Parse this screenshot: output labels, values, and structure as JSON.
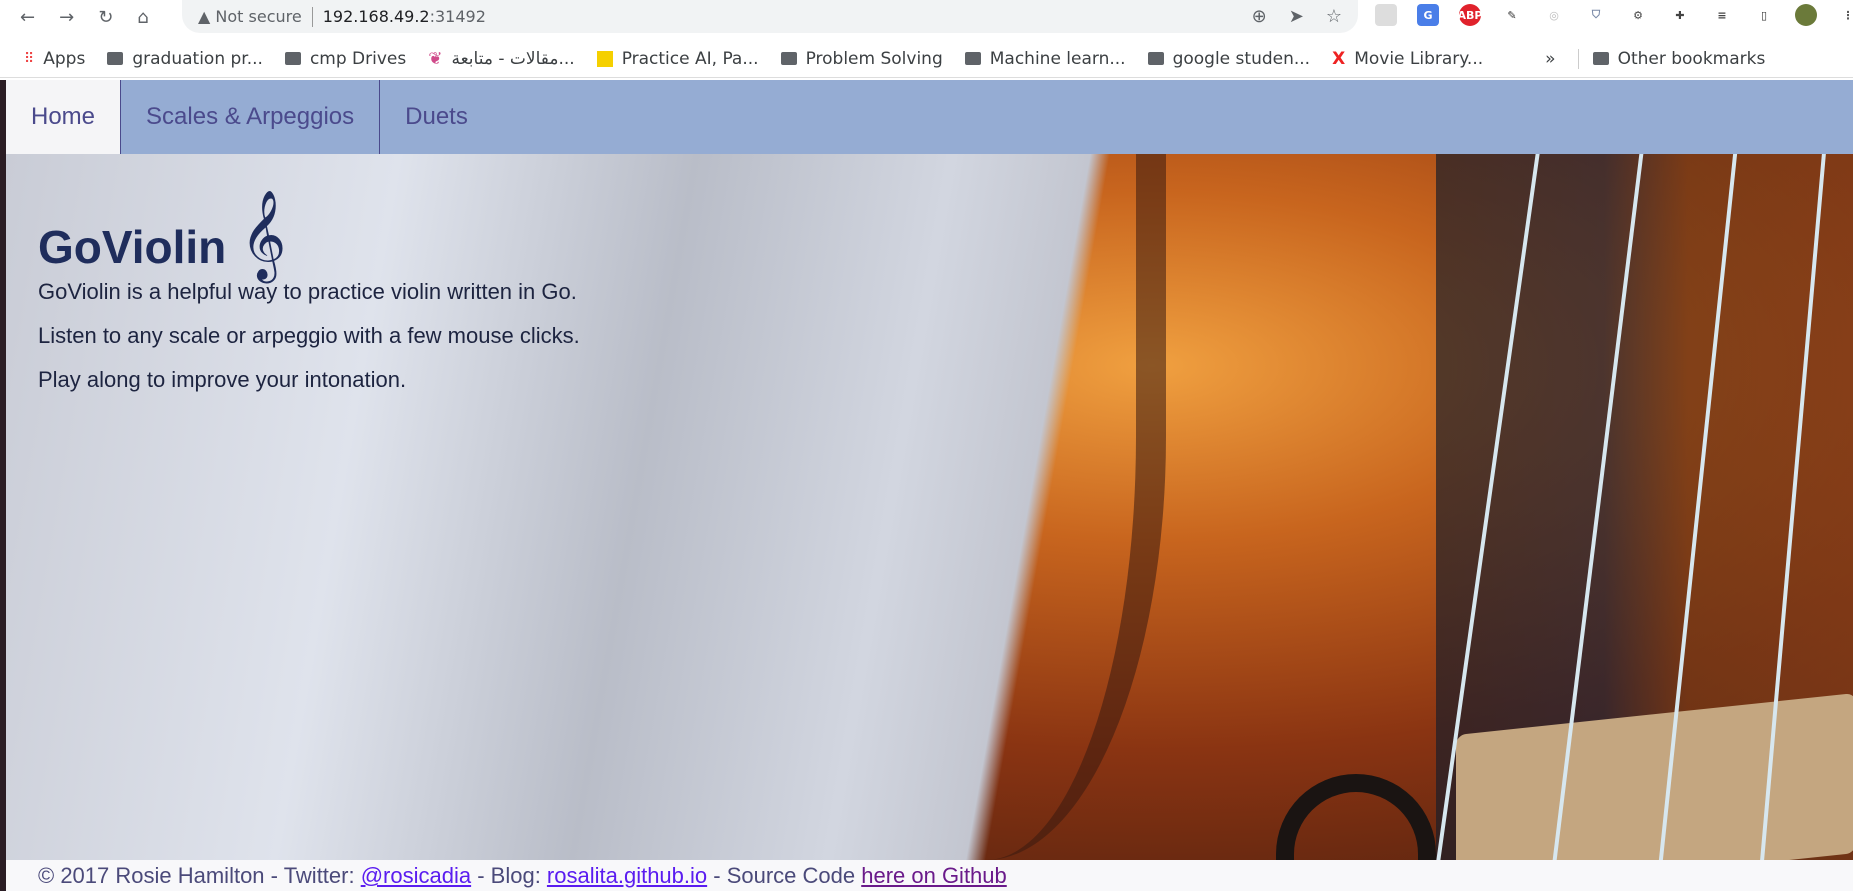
{
  "browser": {
    "security_label": "Not secure",
    "url_host": "192.168.49.2",
    "url_port": ":31492",
    "bookmarks": [
      {
        "label": "Apps",
        "icon": "apps-grid-icon"
      },
      {
        "label": "graduation pr...",
        "icon": "folder-icon"
      },
      {
        "label": "cmp Drives",
        "icon": "folder-icon"
      },
      {
        "label": "مقالات - متابعة...",
        "icon": "site-icon"
      },
      {
        "label": "Practice AI, Pa...",
        "icon": "site-icon"
      },
      {
        "label": "Problem Solving",
        "icon": "folder-icon"
      },
      {
        "label": "Machine learn...",
        "icon": "folder-icon"
      },
      {
        "label": "google studen...",
        "icon": "folder-icon"
      },
      {
        "label": "Movie Library...",
        "icon": "x-icon"
      }
    ],
    "overflow": "»",
    "other_bookmarks": "Other bookmarks"
  },
  "nav": {
    "tabs": [
      {
        "label": "Home",
        "active": true
      },
      {
        "label": "Scales & Arpeggios"
      },
      {
        "label": "Duets"
      }
    ]
  },
  "hero": {
    "title": "GoViolin",
    "clef": "𝄞",
    "paragraphs": [
      "GoViolin is a helpful way to practice violin written in Go.",
      "Listen to any scale or arpeggio with a few mouse clicks.",
      "Play along to improve your intonation."
    ]
  },
  "footer": {
    "prefix": "© 2017 Rosie Hamilton - Twitter: ",
    "twitter": "@rosicadia",
    "blog_prefix": " - Blog: ",
    "blog": "rosalita.github.io",
    "source_prefix": " - Source Code ",
    "source": "here on Github"
  },
  "colors": {
    "nav_bg": "#95acd3",
    "nav_text": "#4b4a8c",
    "title": "#1f2d5c",
    "link": "#5a1cf0"
  }
}
